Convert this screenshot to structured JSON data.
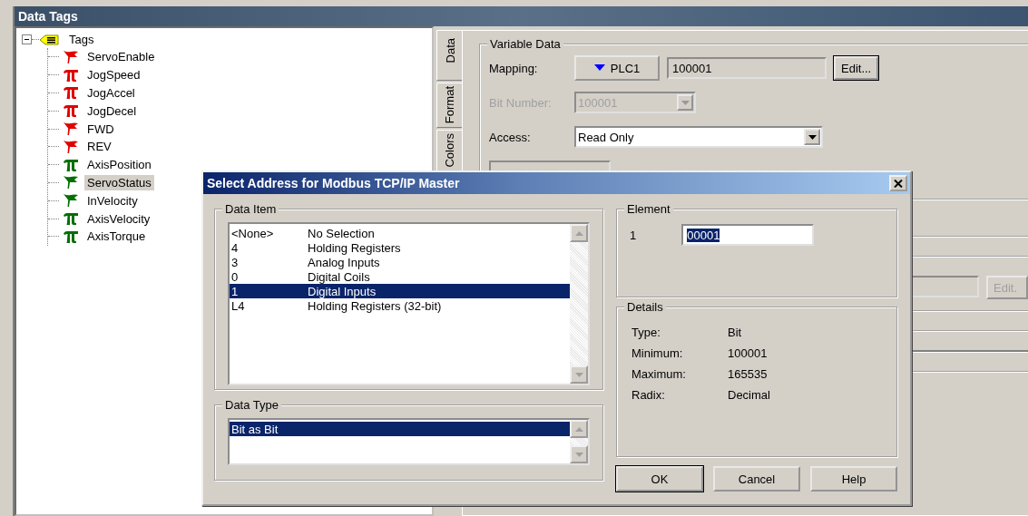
{
  "window": {
    "title": "Data Tags"
  },
  "tree": {
    "label": "Tags",
    "expanded": true,
    "children": [
      {
        "label": "ServoEnable",
        "kind": "flag",
        "color": "#e00000",
        "selected": false
      },
      {
        "label": "JogSpeed",
        "kind": "pi",
        "color": "#e00000",
        "selected": false
      },
      {
        "label": "JogAccel",
        "kind": "pi",
        "color": "#e00000",
        "selected": false
      },
      {
        "label": "JogDecel",
        "kind": "pi",
        "color": "#e00000",
        "selected": false
      },
      {
        "label": "FWD",
        "kind": "flag",
        "color": "#e00000",
        "selected": false
      },
      {
        "label": "REV",
        "kind": "flag",
        "color": "#e00000",
        "selected": false
      },
      {
        "label": "AxisPosition",
        "kind": "pi",
        "color": "#007000",
        "selected": false
      },
      {
        "label": "ServoStatus",
        "kind": "flag",
        "color": "#007000",
        "selected": true
      },
      {
        "label": "InVelocity",
        "kind": "flag",
        "color": "#007000",
        "selected": false
      },
      {
        "label": "AxisVelocity",
        "kind": "pi",
        "color": "#007000",
        "selected": false
      },
      {
        "label": "AxisTorque",
        "kind": "pi",
        "color": "#007000",
        "selected": false
      }
    ]
  },
  "tabs": [
    {
      "label": "Data",
      "selected": true
    },
    {
      "label": "Format",
      "selected": false
    },
    {
      "label": "Colors",
      "selected": false
    }
  ],
  "variable_data": {
    "title": "Variable Data",
    "mapping": {
      "label": "Mapping:",
      "device": "PLC1",
      "address": "100001",
      "edit_button": "Edit..."
    },
    "bit_number": {
      "label": "Bit Number:",
      "value": "100001",
      "disabled": true
    },
    "access": {
      "label": "Access:",
      "value": "Read Only"
    }
  },
  "background_edit_button": {
    "label": "Edit.",
    "disabled": true
  },
  "dialog": {
    "title": "Select Address for Modbus TCP/IP Master",
    "data_item": {
      "title": "Data Item",
      "rows": [
        {
          "code": "<None>",
          "name": "No Selection",
          "selected": false
        },
        {
          "code": "4",
          "name": "Holding Registers",
          "selected": false
        },
        {
          "code": "3",
          "name": "Analog Inputs",
          "selected": false
        },
        {
          "code": "0",
          "name": "Digital Coils",
          "selected": false
        },
        {
          "code": "1",
          "name": "Digital Inputs",
          "selected": true
        },
        {
          "code": "L4",
          "name": "Holding Registers (32-bit)",
          "selected": false
        }
      ]
    },
    "data_type": {
      "title": "Data Type",
      "rows": [
        {
          "label": "Bit as Bit",
          "selected": true
        }
      ]
    },
    "element": {
      "title": "Element",
      "label": "1",
      "value": "00001"
    },
    "details": {
      "title": "Details",
      "rows": [
        {
          "label": "Type:",
          "value": "Bit"
        },
        {
          "label": "Minimum:",
          "value": "100001"
        },
        {
          "label": "Maximum:",
          "value": "165535"
        },
        {
          "label": "Radix:",
          "value": "Decimal"
        }
      ]
    },
    "buttons": [
      {
        "label": "OK",
        "default": true
      },
      {
        "label": "Cancel",
        "default": false
      },
      {
        "label": "Help",
        "default": false
      }
    ]
  }
}
